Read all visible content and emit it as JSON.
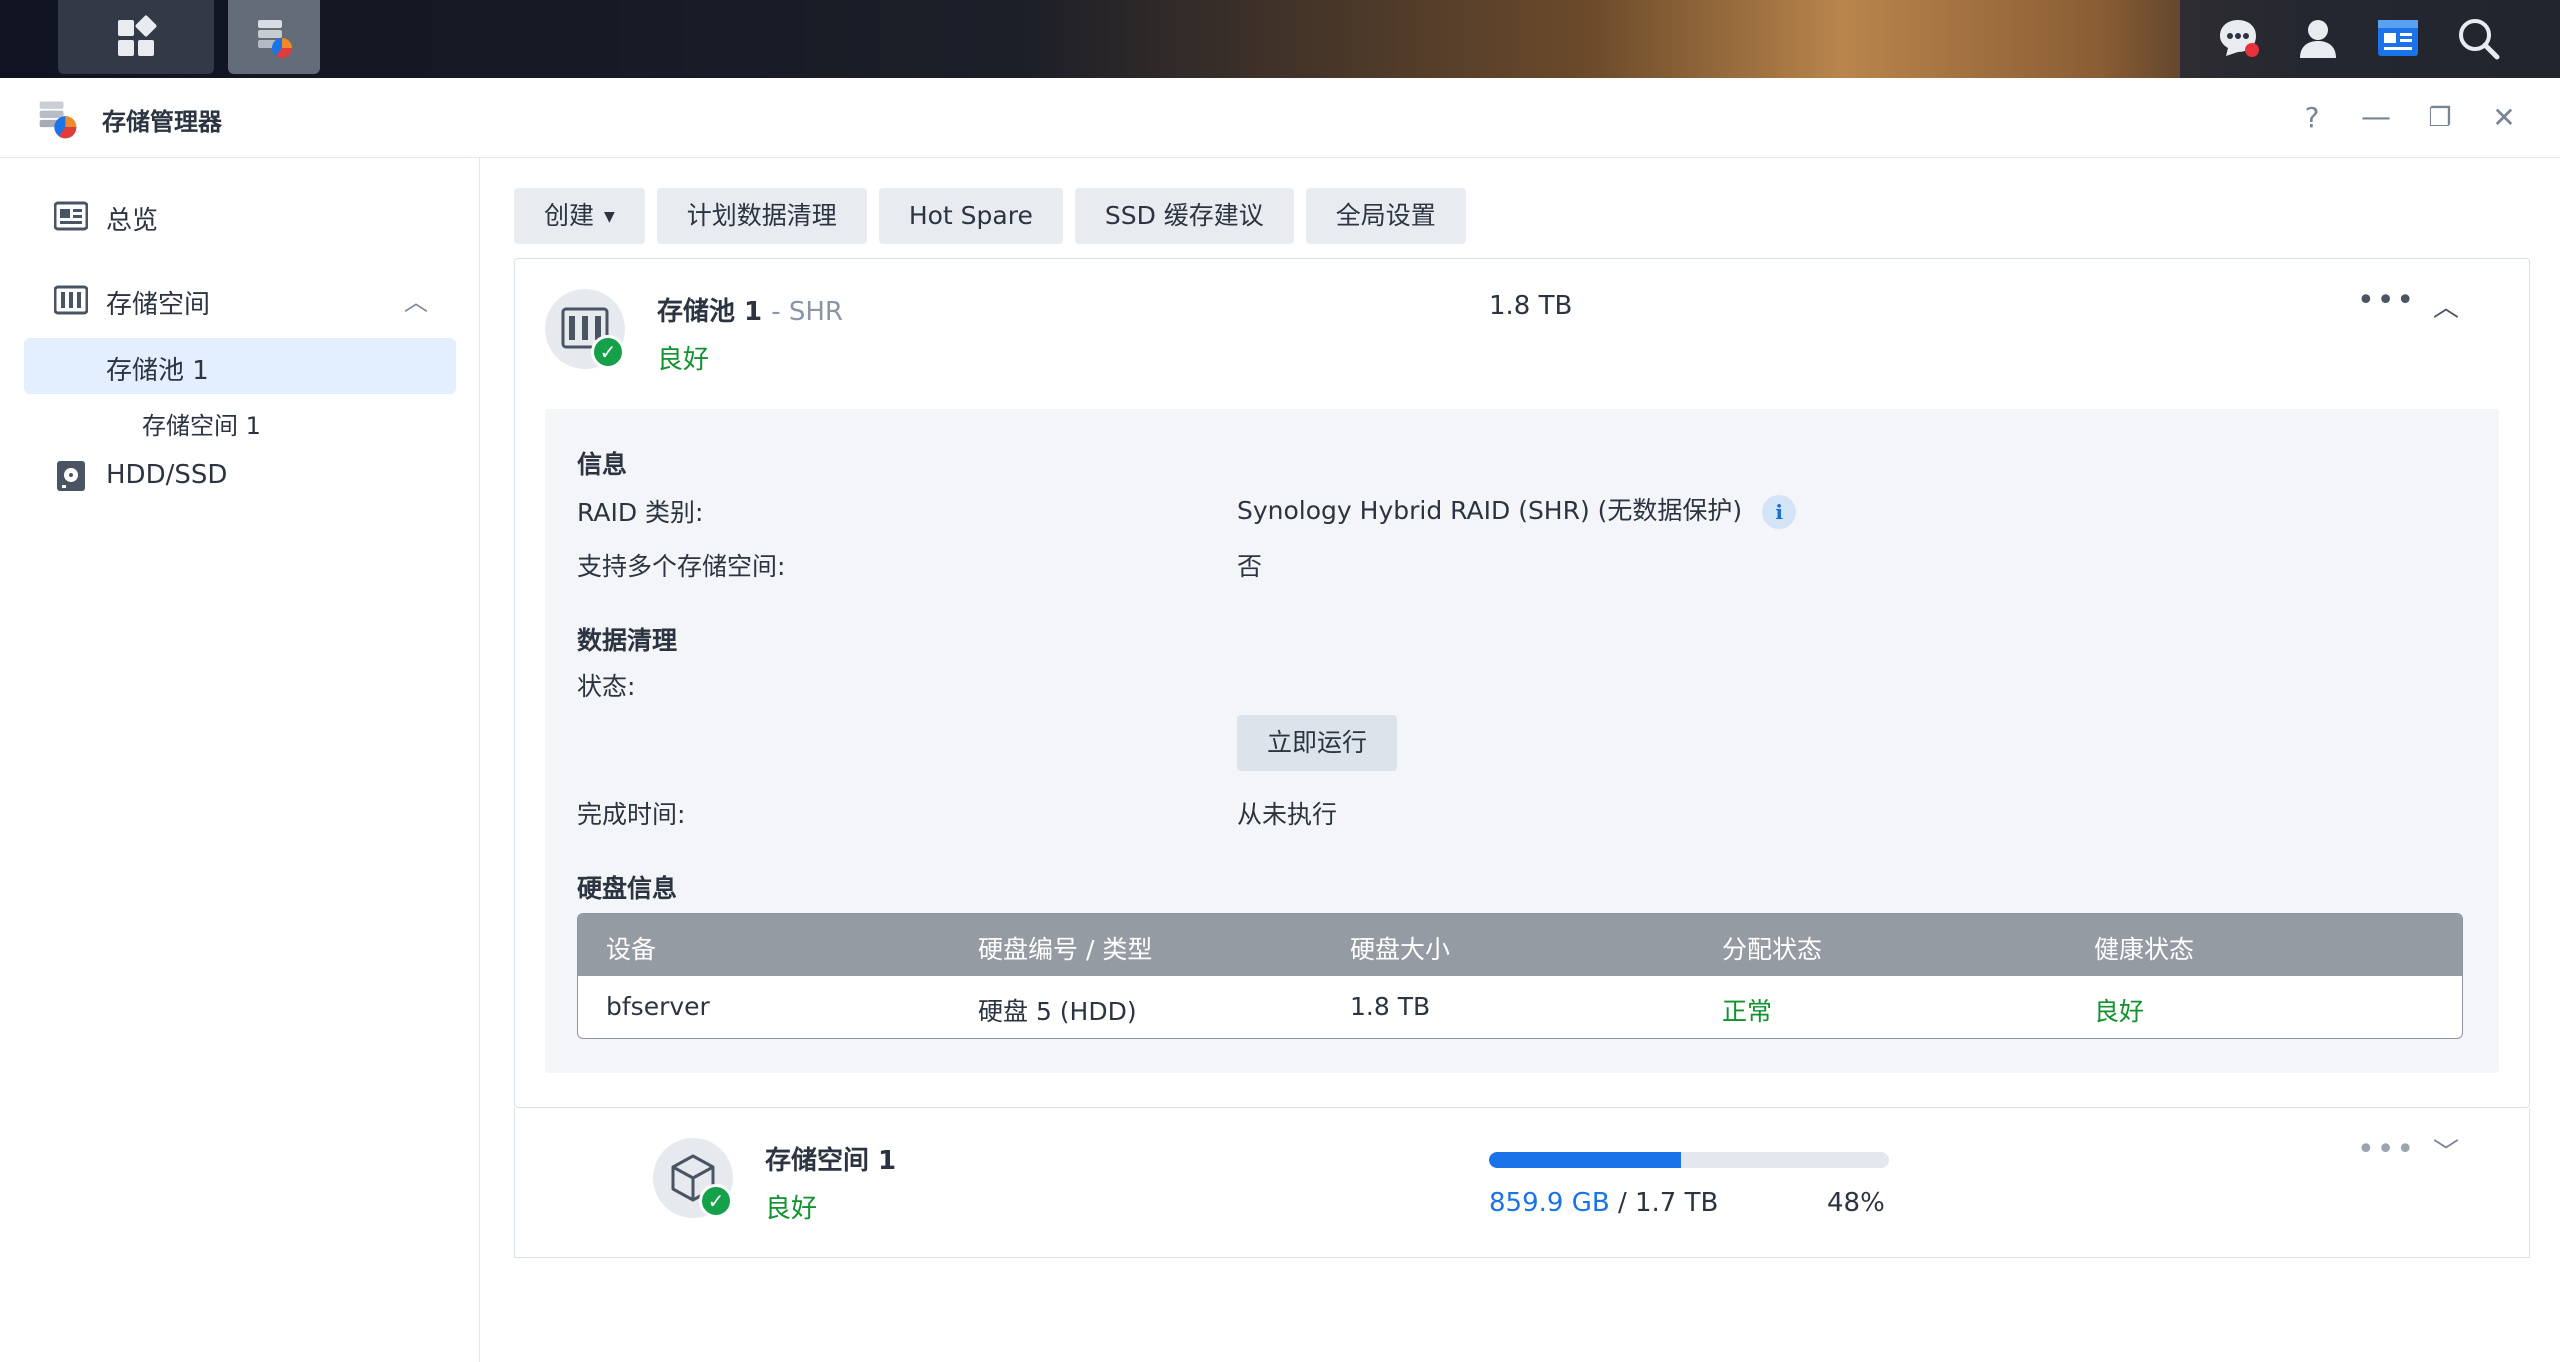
{
  "app": {
    "title": "存储管理器"
  },
  "window_controls": {
    "help": "?",
    "minimize": "—",
    "restore": "❐",
    "close": "✕"
  },
  "sidebar": {
    "items": [
      {
        "label": "总览",
        "icon": "overview-icon"
      },
      {
        "label": "存储空间",
        "icon": "storage-icon",
        "expanded": true
      },
      {
        "label": "存储池 1",
        "active": true
      },
      {
        "label": "存储空间 1"
      },
      {
        "label": "HDD/SSD",
        "icon": "hdd-icon"
      }
    ]
  },
  "toolbar": {
    "create": "创建",
    "scrub_schedule": "计划数据清理",
    "hot_spare": "Hot Spare",
    "ssd_cache": "SSD 缓存建议",
    "global_settings": "全局设置"
  },
  "pool": {
    "name": "存储池 1",
    "type": "- SHR",
    "status": "良好",
    "size": "1.8 TB",
    "info": {
      "title": "信息",
      "raid_label": "RAID 类别:",
      "raid_value": "Synology Hybrid RAID (SHR) (无数据保护)",
      "multi_label": "支持多个存储空间:",
      "multi_value": "否"
    },
    "scrub": {
      "title": "数据清理",
      "state_label": "状态:",
      "run_now": "立即运行",
      "done_label": "完成时间:",
      "done_value": "从未执行"
    },
    "disks": {
      "title": "硬盘信息",
      "headers": [
        "设备",
        "硬盘编号 / 类型",
        "硬盘大小",
        "分配状态",
        "健康状态"
      ],
      "rows": [
        [
          "bfserver",
          "硬盘 5 (HDD)",
          "1.8 TB",
          "正常",
          "良好"
        ]
      ]
    }
  },
  "volume": {
    "name": "存储空间 1",
    "status": "良好",
    "used": "859.9 GB",
    "separator": " / ",
    "total": "1.7 TB",
    "percent_label": "48%",
    "percent": 48
  },
  "colors": {
    "accent": "#1a73e8",
    "good": "#12922f",
    "badge": "#15a04a"
  }
}
